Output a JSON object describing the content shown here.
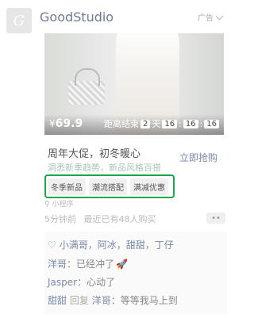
{
  "avatar": {
    "letter": "G"
  },
  "brand": "GoodStudio",
  "ad_label": "广告",
  "card": {
    "price": "69.9",
    "currency": "¥",
    "countdown": {
      "label": "距离结束",
      "days": "2",
      "day_unit": "天",
      "hours": "16",
      "minutes": "16",
      "seconds": "16"
    }
  },
  "promo": {
    "title": "周年大促，初冬暖心",
    "subtitle": "洞悉新季趋势，新品风格百搭",
    "cta": "立即抢购"
  },
  "tags": [
    "冬季新品",
    "潮流搭配",
    "满减优惠"
  ],
  "mini_program": "小程序",
  "meta": {
    "time": "5分钟前",
    "recent": "最近已有48人购买"
  },
  "likes": {
    "names": "小满哥，阿冰，甜甜，丁仔"
  },
  "comments": [
    {
      "name": "洋哥",
      "text": "已经冲了",
      "emoji": "🚀"
    },
    {
      "name": "Jasper",
      "text": "心动了"
    },
    {
      "name": "甜甜",
      "reply_label": "回复",
      "reply_to": "洋哥",
      "text": "等等我马上到"
    }
  ]
}
